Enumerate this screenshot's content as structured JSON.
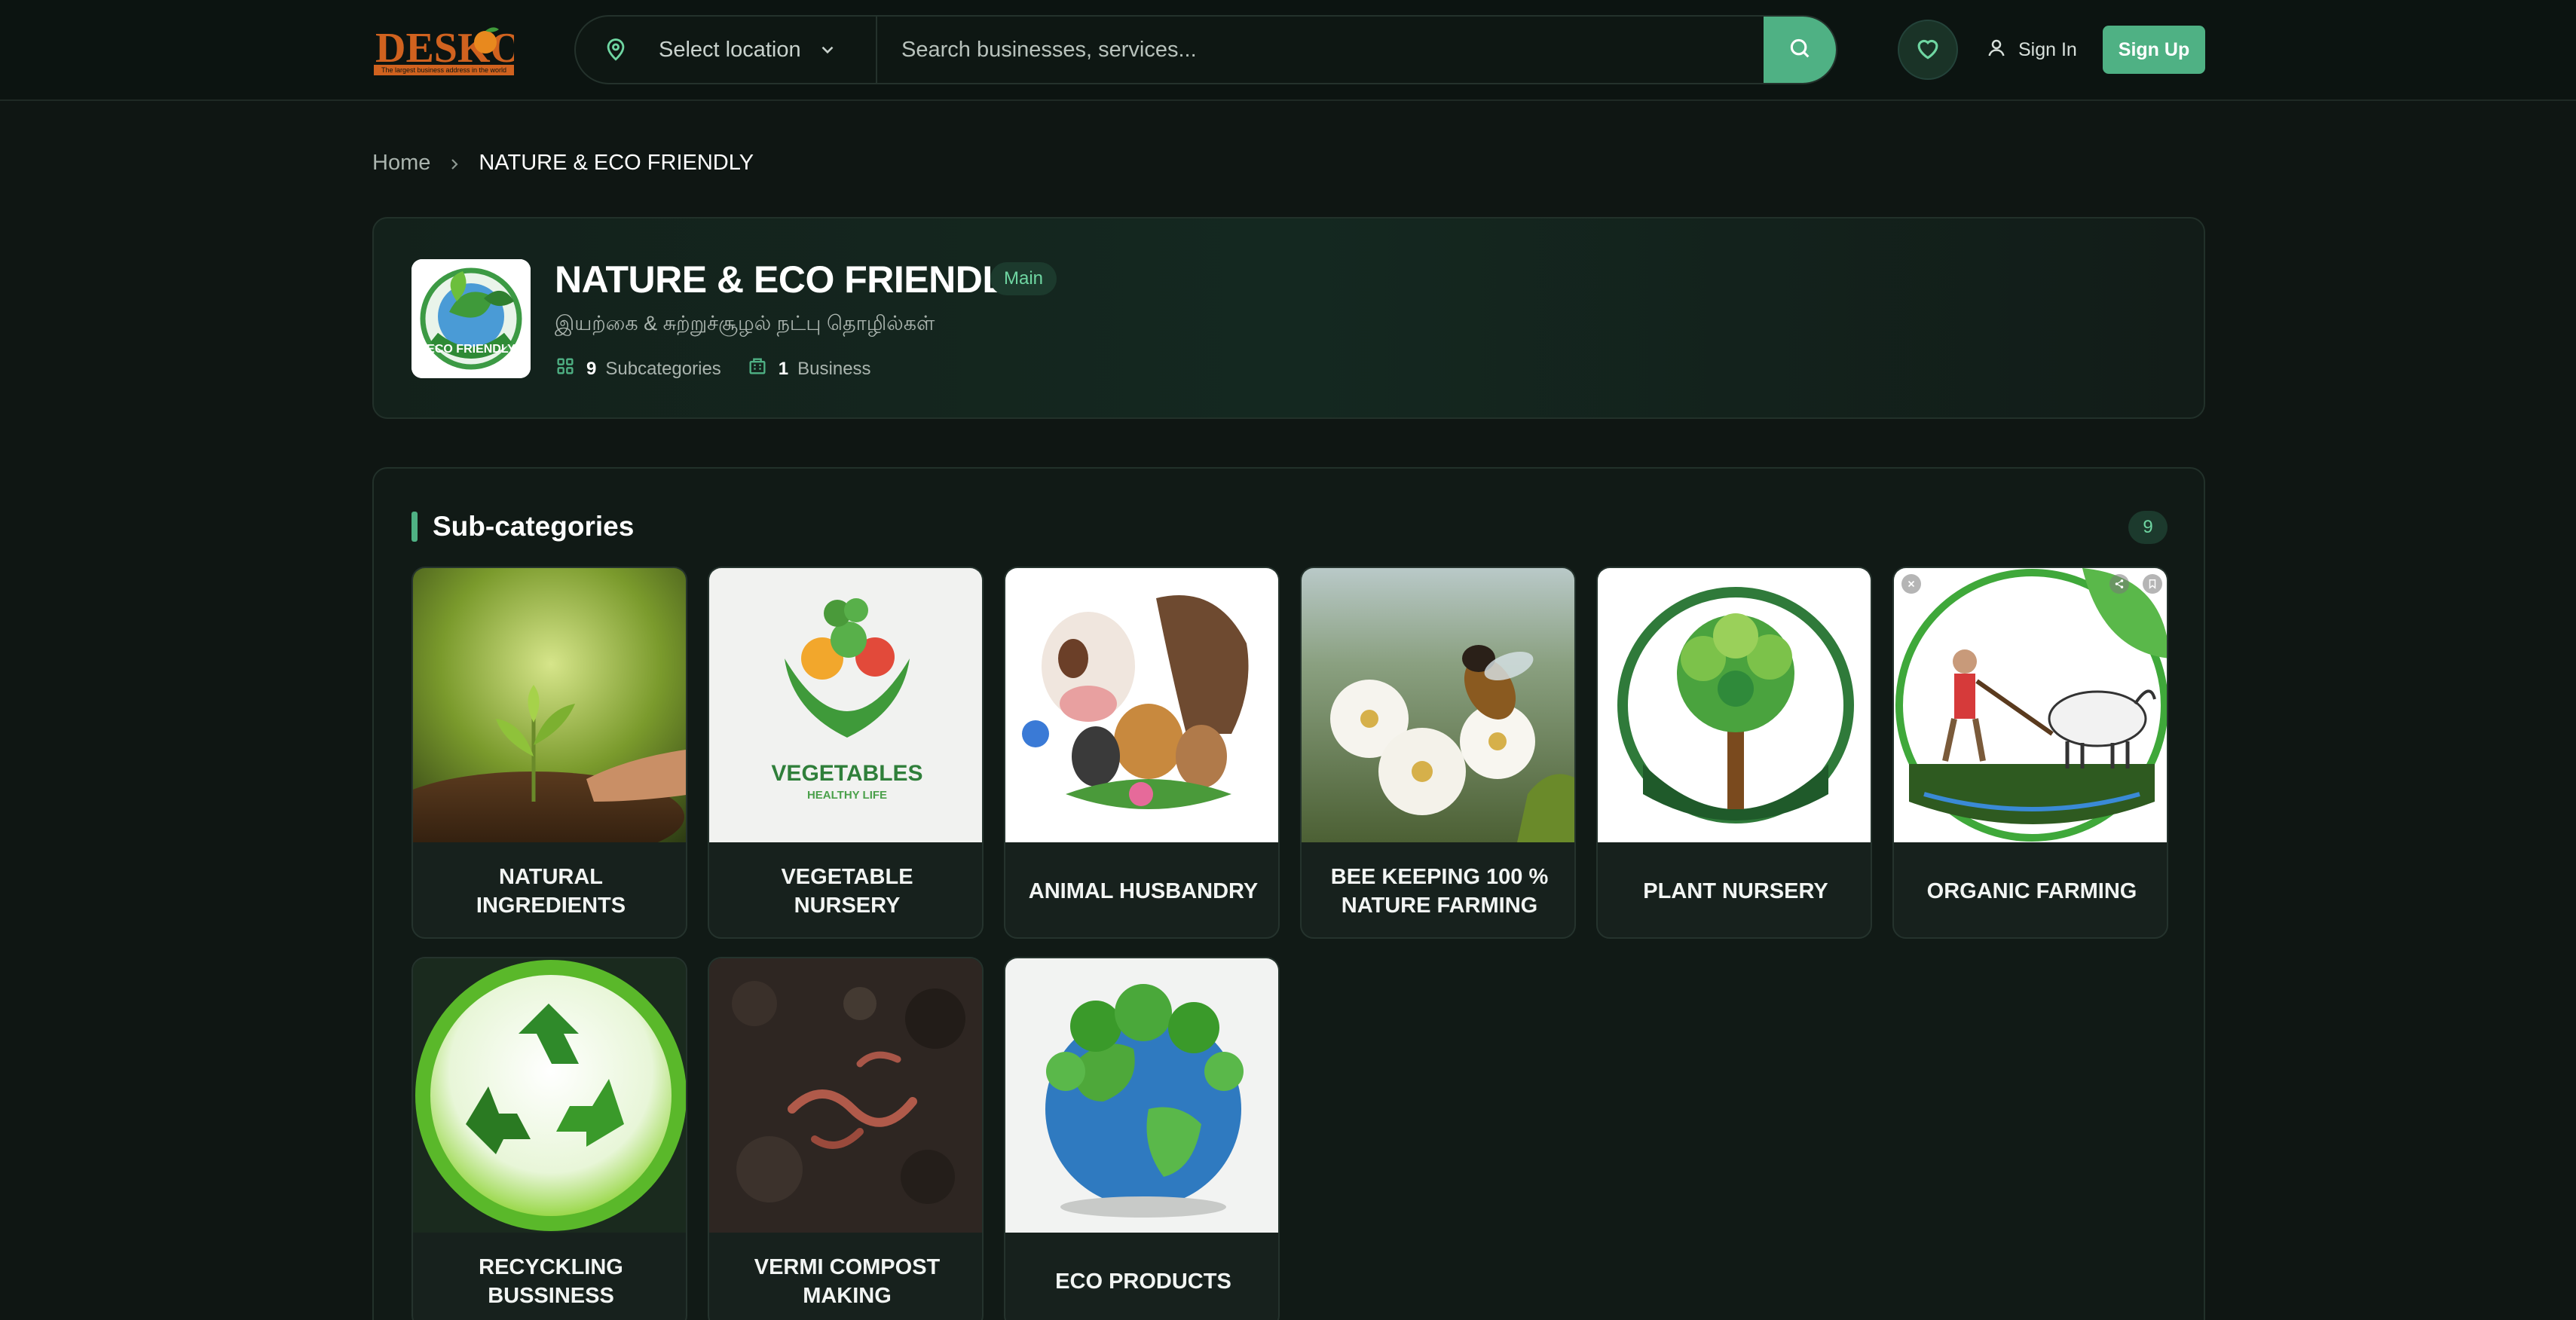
{
  "header": {
    "logo_text": "DESKON",
    "logo_tagline": "The largest business address in the world",
    "location_label": "Select location",
    "search_placeholder": "Search businesses, services...",
    "signin_label": "Sign In",
    "signup_label": "Sign Up",
    "icons": [
      "map-pin-icon",
      "chevron-down-icon",
      "search-icon",
      "heart-icon",
      "user-icon"
    ]
  },
  "breadcrumb": {
    "home": "Home",
    "current": "NATURE & ECO FRIENDLY"
  },
  "category": {
    "title": "NATURE & ECO FRIENDLY",
    "badge": "Main",
    "subtitle": "இயற்கை & சுற்றுச்சூழல் நட்பு தொழில்கள்",
    "subcategory_count": "9",
    "subcategory_label": "Subcategories",
    "business_count": "1",
    "business_label": "Business",
    "logo_text": "ECO FRIENDLY"
  },
  "subcategories": {
    "title": "Sub-categories",
    "count": "9",
    "items": [
      {
        "label": "NATURAL INGREDIENTS"
      },
      {
        "label": "VEGETABLE NURSERY",
        "image_text": "VEGETABLES",
        "image_subtext": "HEALTHY LIFE"
      },
      {
        "label": "ANIMAL HUSBANDRY"
      },
      {
        "label": "BEE KEEPING 100 % NATURE FARMING"
      },
      {
        "label": "PLANT NURSERY"
      },
      {
        "label": "ORGANIC FARMING"
      },
      {
        "label": "RECYCKLING BUSSINESS"
      },
      {
        "label": "VERMI COMPOST MAKING"
      },
      {
        "label": "ECO PRODUCTS"
      }
    ]
  },
  "colors": {
    "accent": "#4fb184",
    "background": "#0f1613",
    "badge_text": "#6fd6a2"
  }
}
